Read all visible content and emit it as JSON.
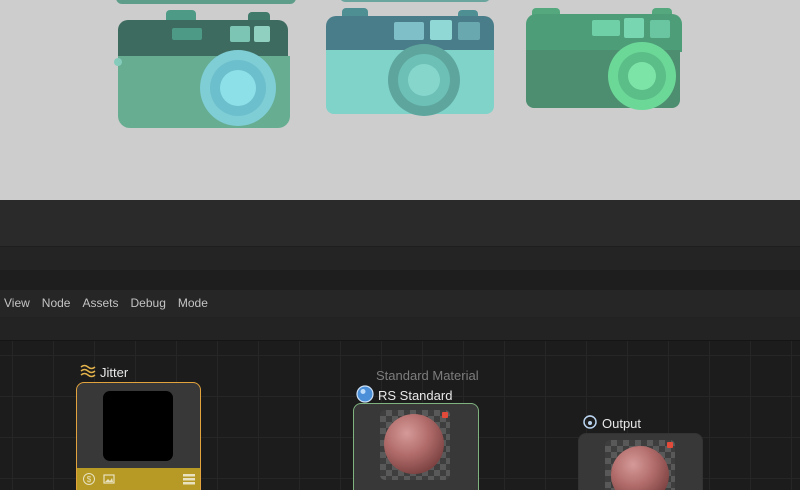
{
  "menu": {
    "items": [
      {
        "label": "View"
      },
      {
        "label": "Node"
      },
      {
        "label": "Assets"
      },
      {
        "label": "Debug"
      },
      {
        "label": "Mode"
      }
    ]
  },
  "nodes": {
    "jitter": {
      "title": "Jitter",
      "icon": "waves-icon",
      "accent": "#e3a33c",
      "footer_color": "#b69a25"
    },
    "rs_standard": {
      "subtitle": "Standard Material",
      "title": "RS Standard",
      "icon": "sphere-icon",
      "accent": "#7fb27f"
    },
    "output": {
      "title": "Output",
      "icon": "output-icon"
    }
  },
  "viewport": {
    "background": "#cdcdcd",
    "objects": [
      "camera-model",
      "camera-model",
      "camera-model"
    ]
  }
}
